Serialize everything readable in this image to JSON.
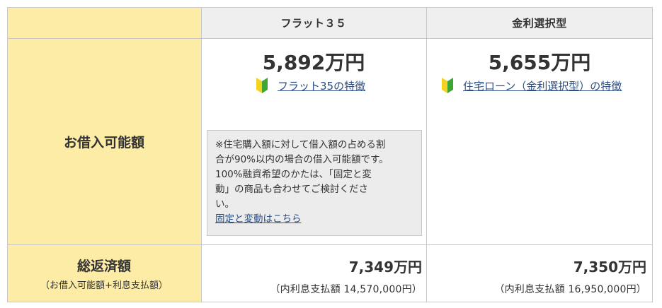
{
  "columns": {
    "col1": "フラット３５",
    "col2": "金利選択型"
  },
  "borrowable": {
    "row_label": "お借入可能額",
    "col1_amount": "5,892万円",
    "col1_link": "フラット35の特徴",
    "col2_amount": "5,655万円",
    "col2_link": "住宅ローン（金利選択型）の特徴",
    "note_lines": [
      "※住宅購入額に対して借入額の占める割",
      "合が90%以内の場合の借入可能額です。",
      "100%融資希望のかたは、「固定と変",
      "動」の商品も合わせてご検討くださ",
      "い。"
    ],
    "note_link": "固定と変動はこちら"
  },
  "total_repayment": {
    "row_label": "総返済額",
    "row_sublabel": "（お借入可能額+利息支払額）",
    "col1_amount": "7,349万円",
    "col1_interest": "（内利息支払額 14,570,000円）",
    "col2_amount": "7,350万円",
    "col2_interest": "（内利息支払額 16,950,000円）"
  },
  "icons": {
    "link_icon": "beginner-leaf-icon",
    "colors": {
      "leaf_green": "#3fa535",
      "leaf_yellow": "#f4d21f"
    }
  },
  "colors": {
    "row_header_bg": "#fdeca6",
    "column_header_bg": "#efefef",
    "border": "#c8c8c8",
    "link": "#2a4f86"
  }
}
